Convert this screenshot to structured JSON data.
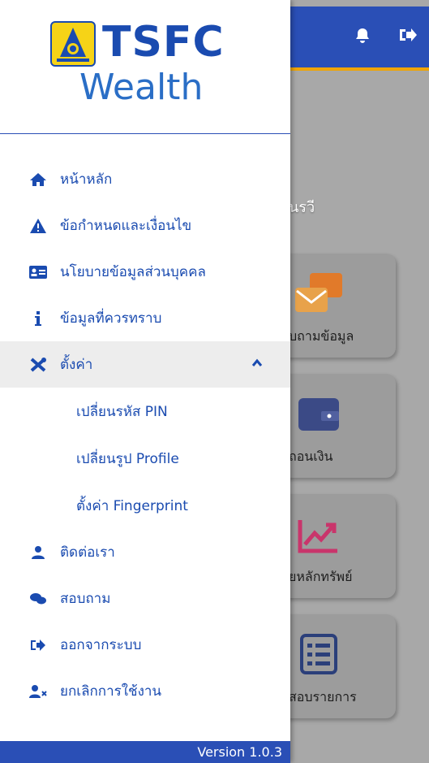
{
  "background": {
    "greeting_fragment": "นรวี",
    "cards": [
      {
        "label": "บถามข้อมูล",
        "icon": "chat-icon"
      },
      {
        "label": "ถอนเงิน",
        "icon": "wallet-icon"
      },
      {
        "label": "ยหลักทรัพย์",
        "icon": "chart-up-icon"
      },
      {
        "label": "สอบรายการ",
        "icon": "list-icon"
      }
    ]
  },
  "logo": {
    "brand": "TSFC",
    "sub": "Wealth"
  },
  "menu": {
    "items": [
      {
        "label": "หน้าหลัก",
        "icon": "home-icon"
      },
      {
        "label": "ข้อกำหนดและเงื่อนไข",
        "icon": "warning-icon"
      },
      {
        "label": "นโยบายข้อมูลส่วนบุคคล",
        "icon": "id-card-icon"
      },
      {
        "label": "ข้อมูลที่ควรทราบ",
        "icon": "info-icon"
      },
      {
        "label": "ตั้งค่า",
        "icon": "tools-icon"
      }
    ],
    "settings_sub": [
      {
        "label": "เปลี่ยนรหัส PIN"
      },
      {
        "label": "เปลี่ยนรูป Profile"
      },
      {
        "label": "ตั้งค่า Fingerprint"
      }
    ],
    "items2": [
      {
        "label": "ติดต่อเรา",
        "icon": "user-icon"
      },
      {
        "label": "สอบถาม",
        "icon": "chat-icon"
      },
      {
        "label": "ออกจากระบบ",
        "icon": "sign-out-icon"
      },
      {
        "label": "ยกเลิกการใช้งาน",
        "icon": "user-remove-icon"
      }
    ]
  },
  "version": "Version 1.0.3",
  "colors": {
    "primary": "#2a4fb6",
    "accent": "#f0a400",
    "overlay": "#a8a8a8",
    "text": "#1a4bb0"
  }
}
